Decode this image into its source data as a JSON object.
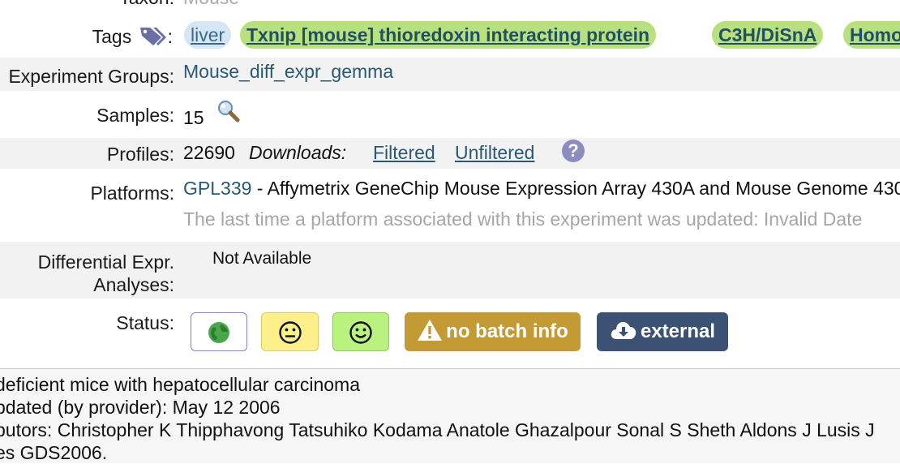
{
  "taxon": {
    "label": "Taxon:",
    "value": "Mouse"
  },
  "tags": {
    "label": "Tags",
    "colon": ":",
    "items": [
      "liver",
      "Txnip [mouse] thioredoxin interacting protein",
      "C3H/DiSnA",
      "Homo"
    ]
  },
  "experiment_groups": {
    "label": "Experiment Groups:",
    "value": "Mouse_diff_expr_gemma"
  },
  "samples": {
    "label": "Samples:",
    "value": "15"
  },
  "profiles": {
    "label": "Profiles:",
    "value": "22690",
    "downloads_label": "Downloads:",
    "filtered": "Filtered",
    "unfiltered": "Unfiltered",
    "help": "?"
  },
  "platforms": {
    "label": "Platforms:",
    "id": "GPL339",
    "description": " - Affymetrix GeneChip Mouse Expression Array 430A and Mouse Genome 430",
    "updated_note": "The last time a platform associated with this experiment was updated: Invalid Date"
  },
  "differential": {
    "label_line1": "Differential Expr.",
    "label_line2": "Analyses:",
    "value": "Not Available"
  },
  "status": {
    "label": "Status:",
    "batch_label": "no batch info",
    "external_label": "external",
    "colors": {
      "batch": "#c49a35",
      "external": "#3c5275",
      "meh": "#fdf08a",
      "smile": "#b9f27e"
    }
  },
  "footer": {
    "line1": "deficient mice with hepatocellular carcinoma",
    "line2": "pdated (by provider): May 12 2006",
    "line3": "butors:  Christopher K Thipphavong Tatsuhiko Kodama Anatole Ghazalpour Sonal S Sheth Aldons J Lusis J",
    "line4": "es GDS2006."
  }
}
